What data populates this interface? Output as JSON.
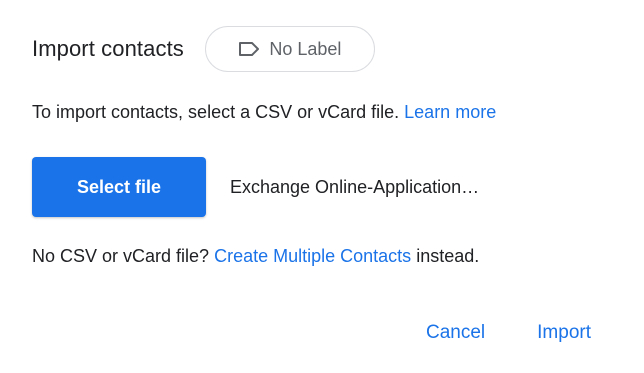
{
  "dialog": {
    "title": "Import contacts",
    "label_chip": {
      "text": "No Label",
      "icon": "label-outline-icon"
    },
    "instructions": {
      "text": "To import contacts, select a CSV or vCard file.",
      "link": "Learn more"
    },
    "file": {
      "select_label": "Select file",
      "selected_name": "Exchange Online-Application…"
    },
    "alternative": {
      "prefix": "No CSV or vCard file?",
      "link": "Create Multiple Contacts",
      "suffix": "instead."
    },
    "actions": {
      "cancel": "Cancel",
      "import": "Import"
    }
  },
  "colors": {
    "accent": "#1a73e8",
    "text": "#202124",
    "muted": "#5f6368",
    "border": "#dadce0"
  }
}
